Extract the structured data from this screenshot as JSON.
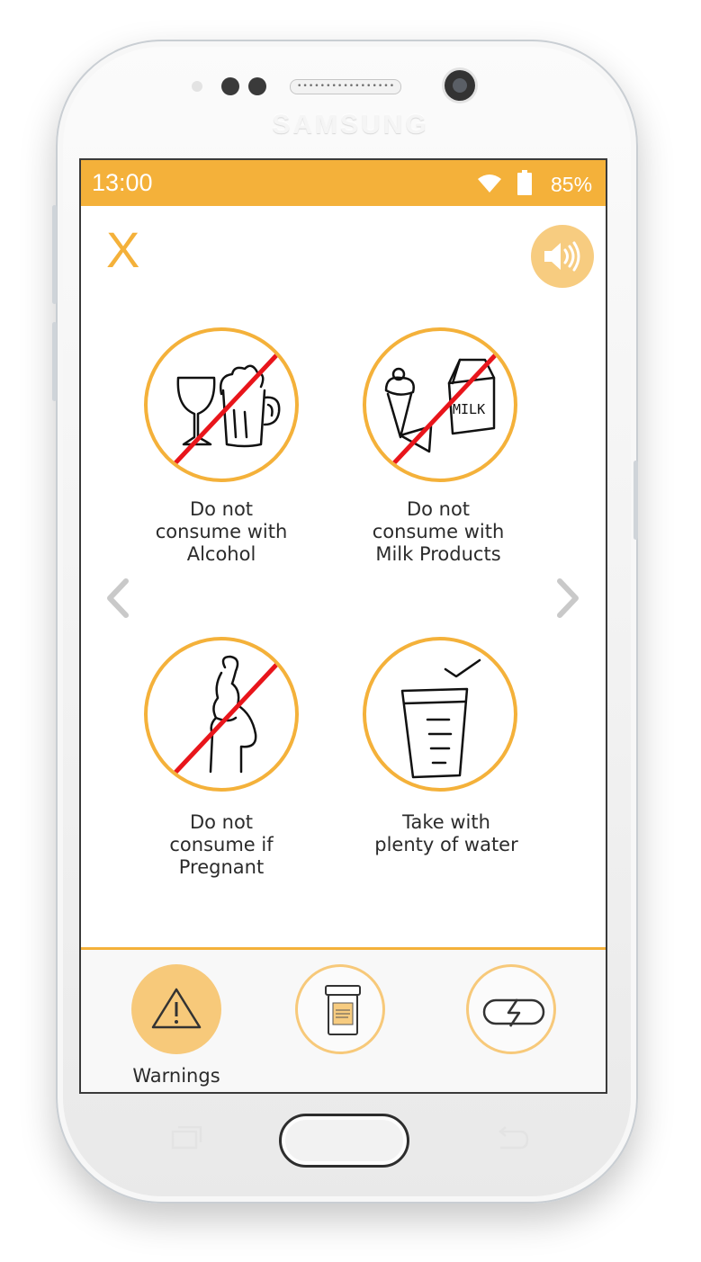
{
  "device": {
    "brand": "SAMSUNG"
  },
  "status_bar": {
    "time": "13:00",
    "battery": "85%",
    "color": "#f4b13a"
  },
  "header": {
    "close_label": "X"
  },
  "warnings": [
    {
      "label": "Do not\nconsume with\nAlcohol",
      "icon": "no-alcohol-icon",
      "prohibited": true
    },
    {
      "label": "Do not\nconsume with\nMilk Products",
      "icon": "no-milk-products-icon",
      "prohibited": true
    },
    {
      "label": "Do not\nconsume if\nPregnant",
      "icon": "no-pregnant-icon",
      "prohibited": true
    },
    {
      "label": "Take with\nplenty of water",
      "icon": "glass-of-water-icon",
      "prohibited": false
    }
  ],
  "tabs": [
    {
      "label": "Warnings",
      "icon": "warning-triangle-icon",
      "active": true
    },
    {
      "label": "",
      "icon": "pill-bottle-icon",
      "active": false
    },
    {
      "label": "",
      "icon": "capsule-icon",
      "active": false
    }
  ],
  "colors": {
    "accent": "#f4b13a",
    "accent_light": "#f7cc80",
    "prohibition": "#e8151b"
  }
}
